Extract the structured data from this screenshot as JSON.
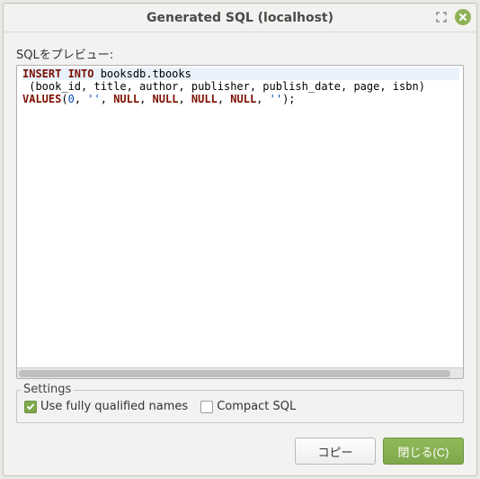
{
  "window": {
    "title": "Generated SQL (localhost)"
  },
  "preview": {
    "label": "SQLをプレビュー:"
  },
  "sql": {
    "kw_insert_into": "INSERT INTO",
    "table": " booksdb.tbooks",
    "columns_line": " (book_id, title, author, publisher, publish_date, page, isbn)",
    "kw_values": "VALUES",
    "open_paren": "(",
    "val_num": "0",
    "sep1": ", ",
    "val_str1": "''",
    "sep2": ", ",
    "val_null1": "NULL",
    "sep3": ", ",
    "val_null2": "NULL",
    "sep4": ", ",
    "val_null3": "NULL",
    "sep5": ", ",
    "val_null4": "NULL",
    "sep6": ", ",
    "val_str2": "''",
    "close": ");"
  },
  "settings": {
    "legend": "Settings",
    "use_fully_qualified": {
      "label": "Use fully qualified names",
      "checked": true
    },
    "compact_sql": {
      "label": "Compact SQL",
      "checked": false
    }
  },
  "footer": {
    "copy": "コピー",
    "close": "閉じる(C)"
  }
}
